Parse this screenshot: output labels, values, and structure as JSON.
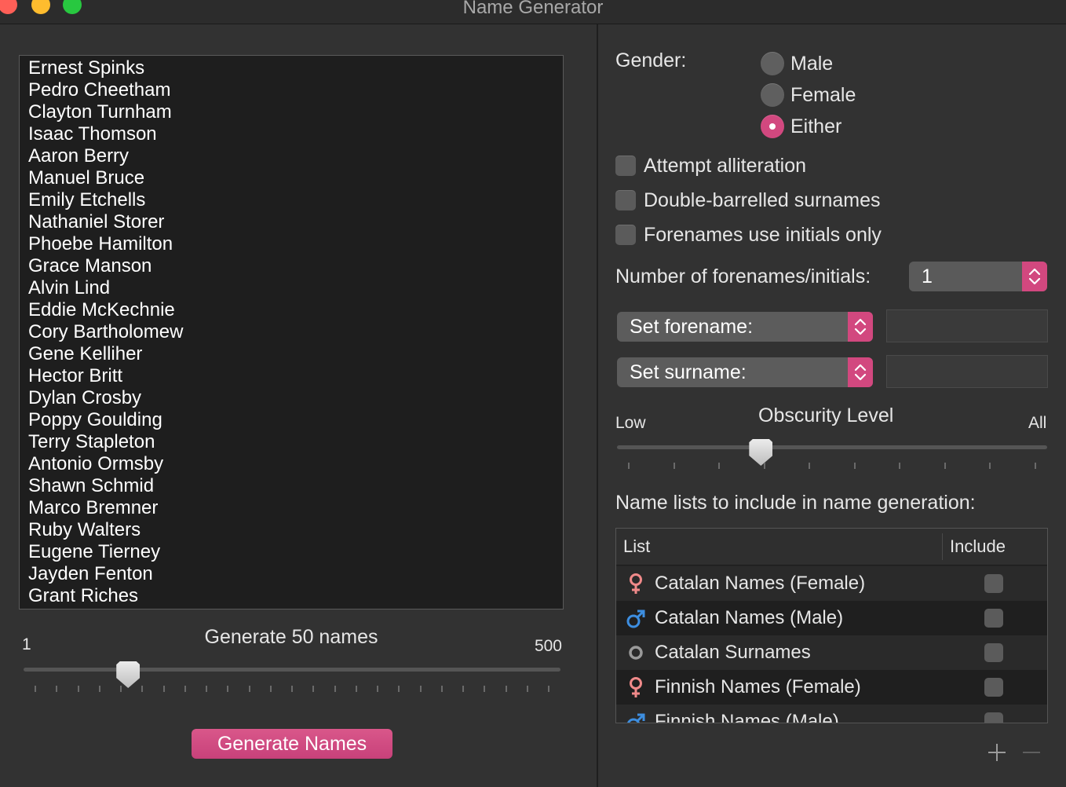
{
  "window": {
    "title": "Name Generator"
  },
  "names": [
    "Ernest Spinks",
    "Pedro Cheetham",
    "Clayton Turnham",
    "Isaac Thomson",
    "Aaron Berry",
    "Manuel Bruce",
    "Emily Etchells",
    "Nathaniel Storer",
    "Phoebe Hamilton",
    "Grace Manson",
    "Alvin Lind",
    "Eddie McKechnie",
    "Cory Bartholomew",
    "Gene Kelliher",
    "Hector Britt",
    "Dylan Crosby",
    "Poppy Goulding",
    "Terry Stapleton",
    "Antonio Ormsby",
    "Shawn Schmid",
    "Marco Bremner",
    "Ruby Walters",
    "Eugene Tierney",
    "Jayden Fenton",
    "Grant Riches"
  ],
  "count_slider": {
    "label": "Generate 50 names",
    "min_label": "1",
    "max_label": "500",
    "value": 50,
    "min": 1,
    "max": 500
  },
  "generate_button": {
    "label": "Generate Names"
  },
  "gender": {
    "label": "Gender:",
    "options": [
      {
        "label": "Male",
        "selected": false
      },
      {
        "label": "Female",
        "selected": false
      },
      {
        "label": "Either",
        "selected": true
      }
    ]
  },
  "options": {
    "alliteration": {
      "label": "Attempt alliteration",
      "checked": false
    },
    "double_barrelled": {
      "label": "Double-barrelled surnames",
      "checked": false
    },
    "initials_only": {
      "label": "Forenames use initials only",
      "checked": false
    }
  },
  "forename_count": {
    "label": "Number of forenames/initials:",
    "value": "1"
  },
  "set_forename": {
    "label": "Set forename:",
    "value": ""
  },
  "set_surname": {
    "label": "Set surname:",
    "value": ""
  },
  "obscurity": {
    "title": "Obscurity Level",
    "low_label": "Low",
    "high_label": "All",
    "level_fraction": 0.325
  },
  "name_lists": {
    "heading": "Name lists to include in name generation:",
    "col_list": "List",
    "col_include": "Include",
    "rows": [
      {
        "label": "Catalan Names (Female)",
        "icon": "female-icon",
        "included": false
      },
      {
        "label": "Catalan Names (Male)",
        "icon": "male-icon",
        "included": false
      },
      {
        "label": "Catalan Surnames",
        "icon": "surname-icon",
        "included": false
      },
      {
        "label": "Finnish Names (Female)",
        "icon": "female-icon",
        "included": false
      },
      {
        "label": "Finnish Names (Male)",
        "icon": "male-icon",
        "included": false
      }
    ]
  },
  "colors": {
    "accent": "#d2487f",
    "female_icon": "#f08a8a",
    "male_icon": "#3d8ee0"
  }
}
